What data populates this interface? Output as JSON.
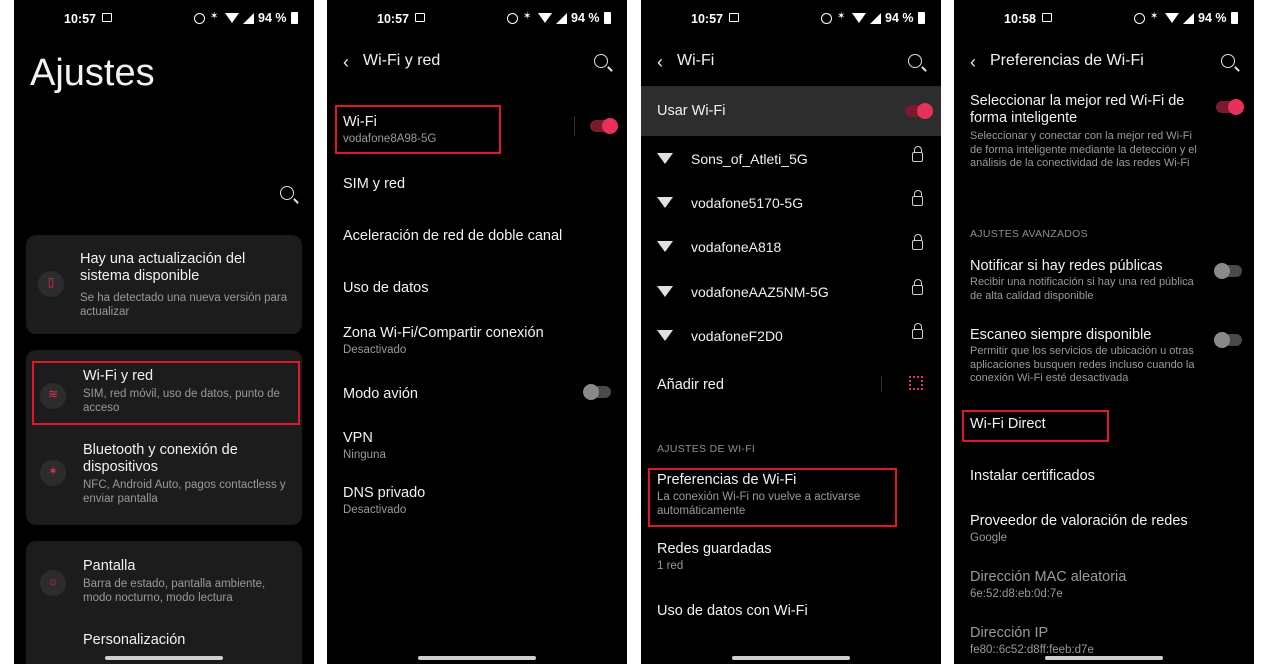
{
  "screens": [
    {
      "time": "10:57",
      "battery": "94 %",
      "title": "Ajustes",
      "update_card": {
        "title": "Hay una actualización del sistema disponible",
        "subtitle": "Se ha detectado una nueva versión para actualizar"
      },
      "items": [
        {
          "title": "Wi-Fi y red",
          "subtitle": "SIM, red móvil, uso de datos, punto de acceso"
        },
        {
          "title": "Bluetooth y conexión de dispositivos",
          "subtitle": "NFC, Android Auto, pagos contactless y enviar pantalla"
        },
        {
          "title": "Pantalla",
          "subtitle": "Barra de estado, pantalla ambiente, modo nocturno, modo lectura"
        },
        {
          "title": "Personalización",
          "subtitle": ""
        }
      ]
    },
    {
      "time": "10:57",
      "battery": "94 %",
      "title": "Wi-Fi y red",
      "items": [
        {
          "title": "Wi-Fi",
          "subtitle": "vodafone8A98-5G"
        },
        {
          "title": "SIM y red",
          "subtitle": ""
        },
        {
          "title": "Aceleración de red de doble canal",
          "subtitle": ""
        },
        {
          "title": "Uso de datos",
          "subtitle": ""
        },
        {
          "title": "Zona Wi-Fi/Compartir conexión",
          "subtitle": "Desactivado"
        },
        {
          "title": "Modo avión",
          "subtitle": ""
        },
        {
          "title": "VPN",
          "subtitle": "Ninguna"
        },
        {
          "title": "DNS privado",
          "subtitle": "Desactivado"
        }
      ]
    },
    {
      "time": "10:57",
      "battery": "94 %",
      "title": "Wi-Fi",
      "use_wifi": "Usar Wi-Fi",
      "networks": [
        "Sons_of_Atleti_5G",
        "vodafone5170-5G",
        "vodafoneA818",
        "vodafoneAAZ5NM-5G",
        "vodafoneF2D0"
      ],
      "add_network": "Añadir red",
      "section": "AJUSTES DE WI-FI",
      "items": [
        {
          "title": "Preferencias de Wi-Fi",
          "subtitle": "La conexión Wi-Fi no vuelve a activarse automáticamente"
        },
        {
          "title": "Redes guardadas",
          "subtitle": "1 red"
        },
        {
          "title": "Uso de datos con Wi-Fi",
          "subtitle": ""
        }
      ]
    },
    {
      "time": "10:58",
      "battery": "94 %",
      "title": "Preferencias de Wi-Fi",
      "top_item": {
        "title": "Seleccionar la mejor red Wi-Fi de forma inteligente",
        "subtitle": "Seleccionar y conectar con la mejor red Wi-Fi de forma inteligente mediante la detección y el análisis de la conectividad de las redes Wi-Fi"
      },
      "section": "AJUSTES AVANZADOS",
      "items": [
        {
          "title": "Notificar si hay redes públicas",
          "subtitle": "Recibir una notificación si hay una red pública de alta calidad disponible"
        },
        {
          "title": "Escaneo siempre disponible",
          "subtitle": "Permitir que los servicios de ubicación u otras aplicaciones busquen redes incluso cuando la conexión Wi-Fi esté desactivada"
        },
        {
          "title": "Wi-Fi Direct",
          "subtitle": ""
        },
        {
          "title": "Instalar certificados",
          "subtitle": ""
        },
        {
          "title": "Proveedor de valoración de redes",
          "subtitle": "Google"
        },
        {
          "title": "Dirección MAC aleatoria",
          "subtitle": "6e:52:d8:eb:0d:7e"
        },
        {
          "title": "Dirección IP",
          "subtitle": "fe80::6c52:d8ff:feeb:d7e"
        }
      ]
    }
  ],
  "colors": {
    "accent": "#e8315a",
    "highlight": "#e0182d",
    "background": "#000000",
    "card": "#1c1c1c"
  }
}
